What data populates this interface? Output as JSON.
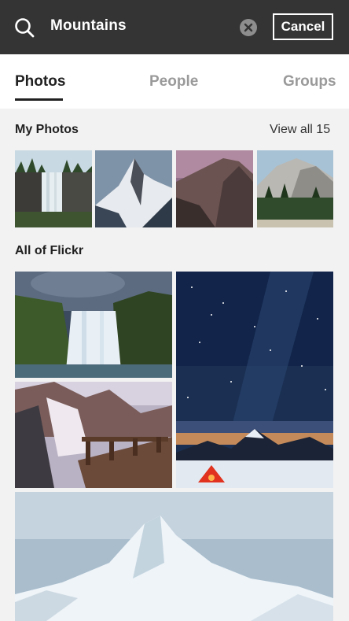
{
  "search": {
    "query": "Mountains",
    "cancel_label": "Cancel"
  },
  "tabs": [
    {
      "label": "Photos",
      "active": true
    },
    {
      "label": "People",
      "active": false
    },
    {
      "label": "Groups",
      "active": false
    }
  ],
  "my_photos": {
    "title": "My Photos",
    "view_all_label": "View all 15"
  },
  "all_flickr": {
    "title": "All of Flickr"
  },
  "colors": {
    "topbar": "#343434",
    "page_bg": "#f2f2f2",
    "active_tab": "#212121",
    "inactive_tab": "#9a9a9a"
  },
  "icons": [
    "search-icon",
    "clear-icon"
  ]
}
